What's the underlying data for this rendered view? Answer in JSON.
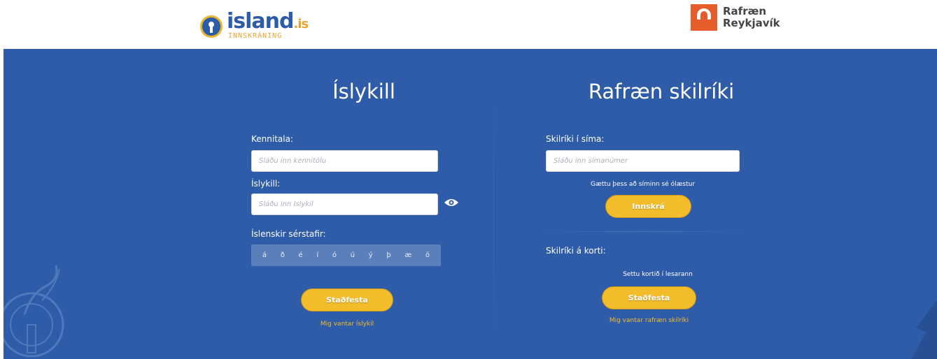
{
  "header": {
    "island_logo": {
      "brand": "island",
      "tld": ".is",
      "sub": "INNSKRÁNING",
      "icon": "keyhole-icon"
    },
    "rvk_logo": {
      "line1": "Rafræn",
      "line2": "Reykjavík",
      "icon": "rvk-mark-icon"
    }
  },
  "islykill": {
    "title": "Íslykill",
    "kennitala_label": "Kennitala:",
    "kennitala_placeholder": "Sláðu inn kennitölu",
    "islykill_label": "Íslykill:",
    "islykill_placeholder": "Sláðu inn Íslykil",
    "show_password_icon": "eye-icon",
    "special_chars_label": "Íslenskir sérstafir:",
    "special_chars": [
      "á",
      "ð",
      "é",
      "í",
      "ó",
      "ú",
      "ý",
      "þ",
      "æ",
      "ö"
    ],
    "submit_label": "Staðfesta",
    "missing_link": "Mig vantar íslykil"
  },
  "rafraen": {
    "title": "Rafræn skilríki",
    "phone_label": "Skilríki í síma:",
    "phone_placeholder": "Sláðu inn símanúmer",
    "phone_note": "Gættu þess að síminn sé ólæstur",
    "login_label": "Innskrá",
    "card_label": "Skilríki á korti:",
    "card_note": "Settu kortið í lesarann",
    "card_submit_label": "Staðfesta",
    "missing_link": "Mig vantar rafræn skilríki"
  },
  "colors": {
    "background_blue": "#2f5ca9",
    "button_yellow": "#f2bc2a",
    "link_yellow": "#f2bc2a",
    "island_orange": "#e8a52e",
    "rvk_orange": "#e55d2b"
  }
}
